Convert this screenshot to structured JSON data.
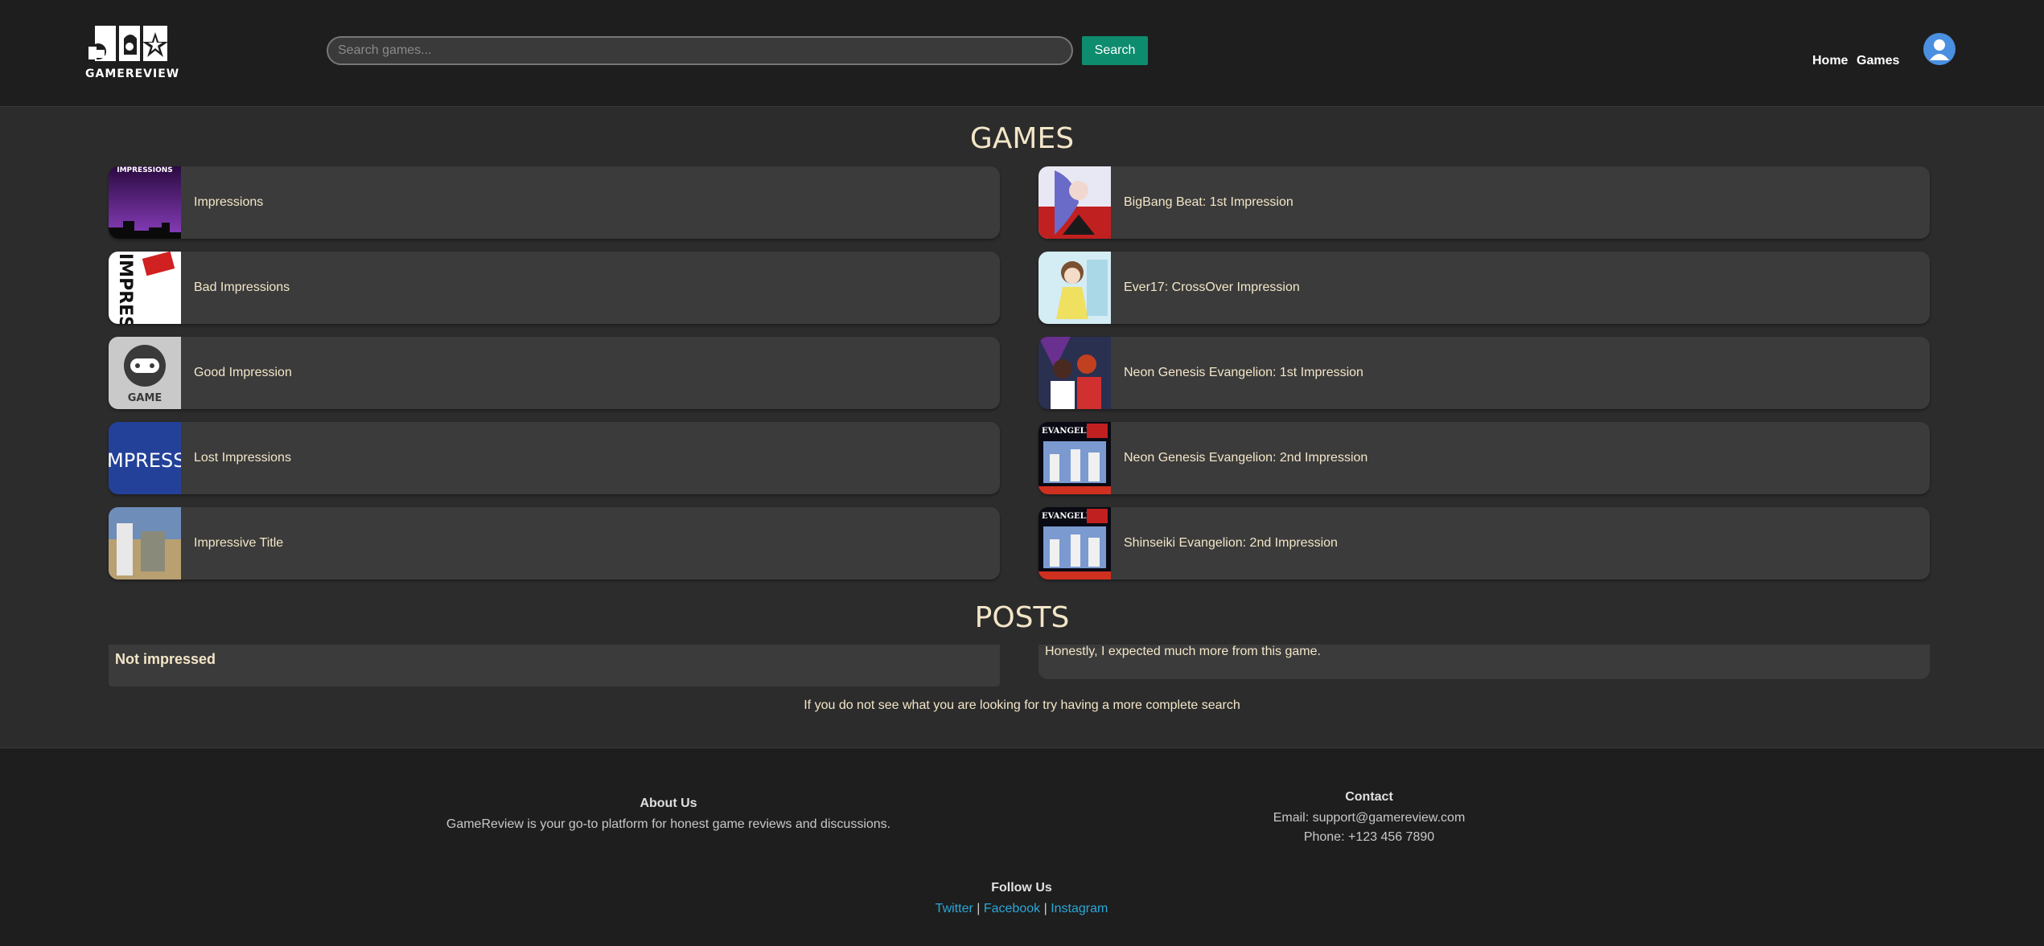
{
  "header": {
    "logo_text": "GAMEREVIEW",
    "search_placeholder": "Search games...",
    "search_button": "Search",
    "nav": {
      "home": "Home",
      "games": "Games"
    }
  },
  "games_section": {
    "title": "GAMES",
    "left": [
      {
        "title": "Impressions",
        "thumb_label": "IMPRESSIONS"
      },
      {
        "title": "Bad Impressions",
        "thumb_label": "IMPRESSION"
      },
      {
        "title": "Good Impression",
        "thumb_label": "GAME"
      },
      {
        "title": "Lost Impressions",
        "thumb_label": "MPRESS"
      },
      {
        "title": "Impressive Title",
        "thumb_label": ""
      }
    ],
    "right": [
      {
        "title": "BigBang Beat: 1st Impression",
        "thumb_label": ""
      },
      {
        "title": "Ever17: CrossOver Impression",
        "thumb_label": ""
      },
      {
        "title": "Neon Genesis Evangelion: 1st Impression",
        "thumb_label": ""
      },
      {
        "title": "Neon Genesis Evangelion: 2nd Impression",
        "thumb_label": "EVANGELION"
      },
      {
        "title": "Shinseiki Evangelion: 2nd Impression",
        "thumb_label": "EVANGELION"
      }
    ]
  },
  "posts_section": {
    "title": "POSTS",
    "post_left_title": "Not impressed",
    "post_right_body": "Honestly, I expected much more from this game."
  },
  "hint": "If you do not see what you are looking for try having a more complete search",
  "footer": {
    "about_heading": "About Us",
    "about_text": "GameReview is your go-to platform for honest game reviews and discussions.",
    "contact_heading": "Contact",
    "email": "Email: support@gamereview.com",
    "phone": "Phone: +123 456 7890",
    "follow_heading": "Follow Us",
    "links": {
      "twitter": "Twitter",
      "facebook": "Facebook",
      "instagram": "Instagram",
      "separator": "|"
    }
  },
  "colors": {
    "accent_search": "#0e8c6e",
    "text_cream": "#f3e6c8",
    "link": "#2aa7d8",
    "avatar": "#4a8fe0"
  }
}
